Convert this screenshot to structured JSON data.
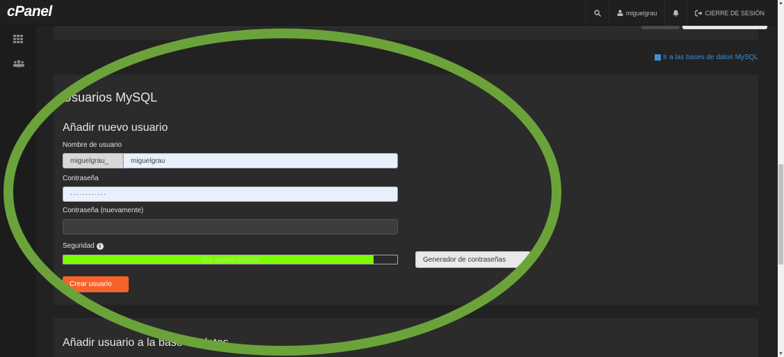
{
  "topbar": {
    "logo": "cPanel",
    "user": "miguelgrau",
    "logout": "CIERRE DE SESIÓN"
  },
  "links": {
    "goto_db": "Ir a las bases de datos MySQL"
  },
  "section": {
    "title": "Usuarios MySQL",
    "add_title": "Añadir nuevo usuario",
    "username_label": "Nombre de usuario",
    "username_prefix": "miguelgrau_",
    "username_value": "miguelgrau",
    "password_label": "Contraseña",
    "password_value": "············",
    "password_again_label": "Contraseña (nuevamente)",
    "password_again_value": "",
    "security_label": "Seguridad",
    "strength_text": "Muy segura (93/100)",
    "strength_percent": 93,
    "generator_button": "Generador de contraseñas",
    "create_button": "Crear usuario"
  },
  "section2": {
    "title": "Añadir usuario a la base de datos"
  },
  "overlay": {
    "ring_color": "#6ba33a"
  }
}
